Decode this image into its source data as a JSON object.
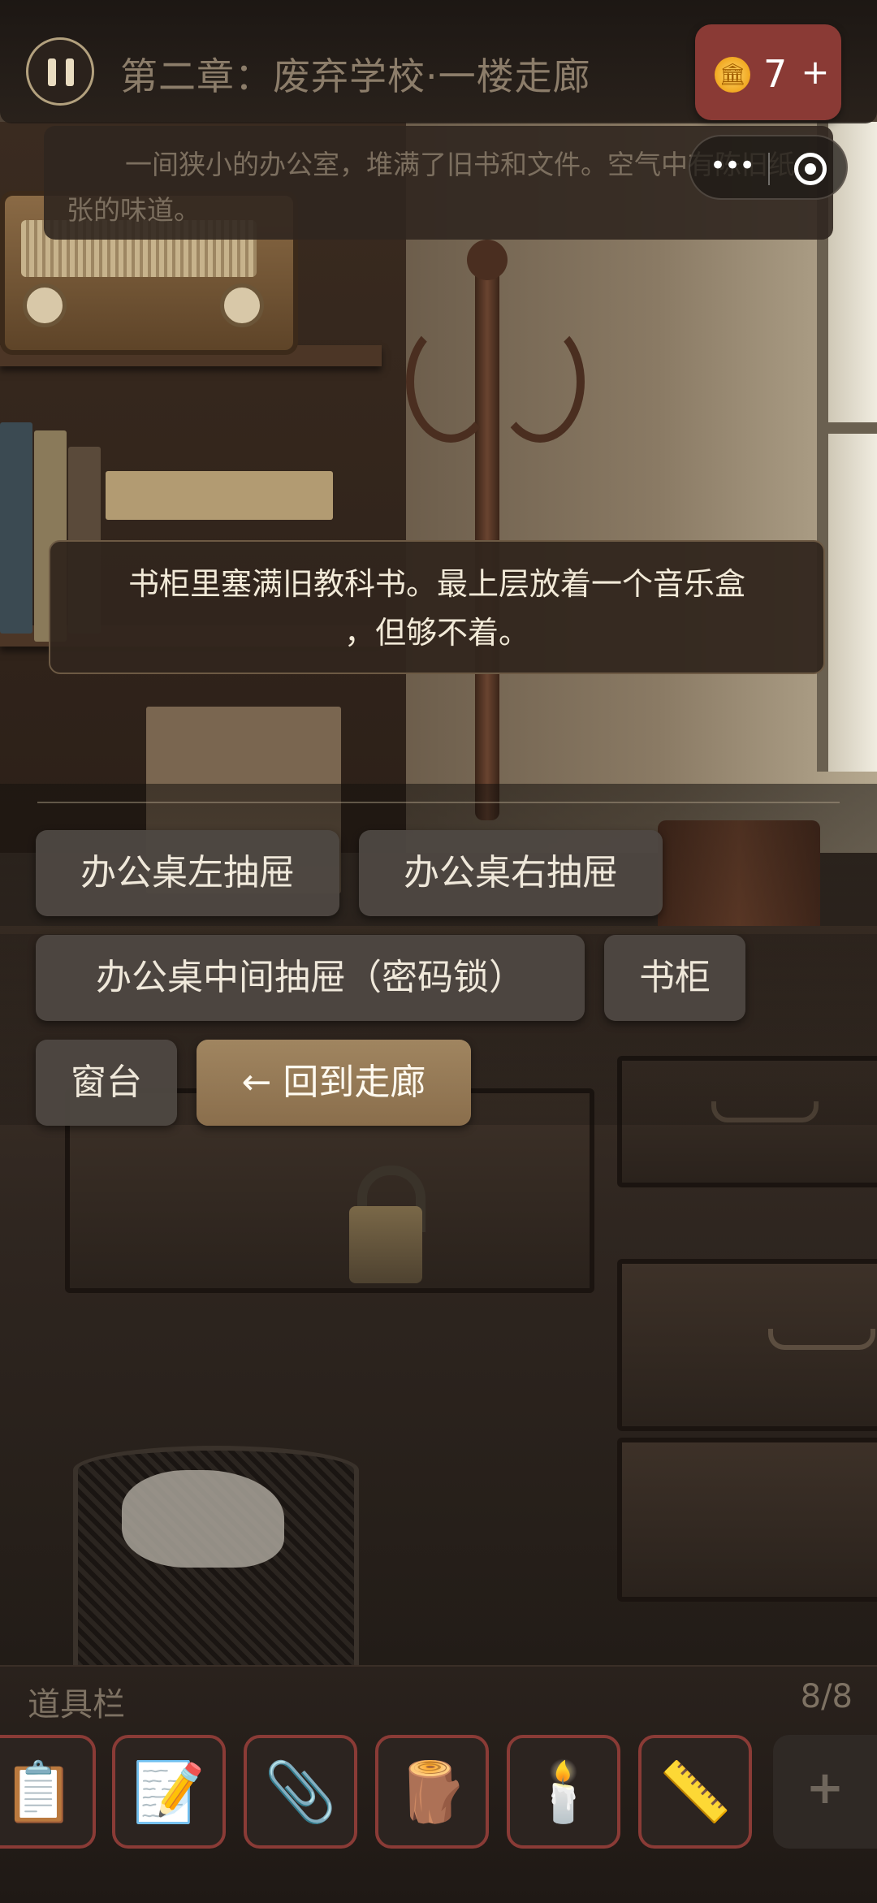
{
  "header": {
    "chapter_title": "第二章：废弃学校·一楼走廊",
    "coin_icon": "🏛",
    "coins": "7",
    "coin_plus": "+"
  },
  "description": "一间狭小的办公室，堆满了旧书和文件。空气中有陈旧纸张的味道。",
  "dialog": {
    "line1": "书柜里塞满旧教科书。最上层放着一个音乐盒",
    "line2": "，但够不着。"
  },
  "actions": [
    {
      "label": "办公桌左抽屉"
    },
    {
      "label": "办公桌右抽屉"
    },
    {
      "label": "办公桌中间抽屉（密码锁）"
    },
    {
      "label": "书柜"
    },
    {
      "label": "窗台"
    },
    {
      "label": "← 回到走廊"
    }
  ],
  "inventory": {
    "title": "道具栏",
    "count": "8/8",
    "items": [
      {
        "icon": "clipboard-icon",
        "glyph": "📋"
      },
      {
        "icon": "memo-icon",
        "glyph": "📝"
      },
      {
        "icon": "paperclip-icon",
        "glyph": "📎"
      },
      {
        "icon": "wood-log-icon",
        "glyph": "🪵"
      },
      {
        "icon": "candle-icon",
        "glyph": "🕯️"
      },
      {
        "icon": "ruler-icon",
        "glyph": "📏"
      }
    ],
    "add_label": "+"
  },
  "colors": {
    "coin_box": "#8a3a35",
    "slot_border": "#8a3b36",
    "back_button": "#9a7e58",
    "action_button": "#4e4842"
  }
}
